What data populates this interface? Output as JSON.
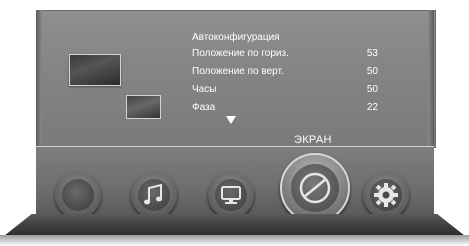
{
  "menu": {
    "title": "Автоконфигурация",
    "items": [
      {
        "label": "Положение по гориз.",
        "value": "53"
      },
      {
        "label": "Положение по верт.",
        "value": "50"
      },
      {
        "label": "Часы",
        "value": "50"
      },
      {
        "label": "Фаза",
        "value": "22"
      }
    ],
    "more_indicator": "down-arrow-icon"
  },
  "dock": {
    "selected_label": "ЭКРАН",
    "items": [
      {
        "name": "picture",
        "icon": "circle-icon"
      },
      {
        "name": "sound",
        "icon": "music-note-icon"
      },
      {
        "name": "source",
        "icon": "monitor-icon"
      },
      {
        "name": "screen",
        "icon": "screen-adjust-icon"
      },
      {
        "name": "settings",
        "icon": "gear-icon"
      }
    ]
  },
  "colors": {
    "panel": "#858585",
    "text": "#ffffff",
    "orb_outer": "#5a5a5a",
    "orb_inner": "#3a3a3a"
  }
}
